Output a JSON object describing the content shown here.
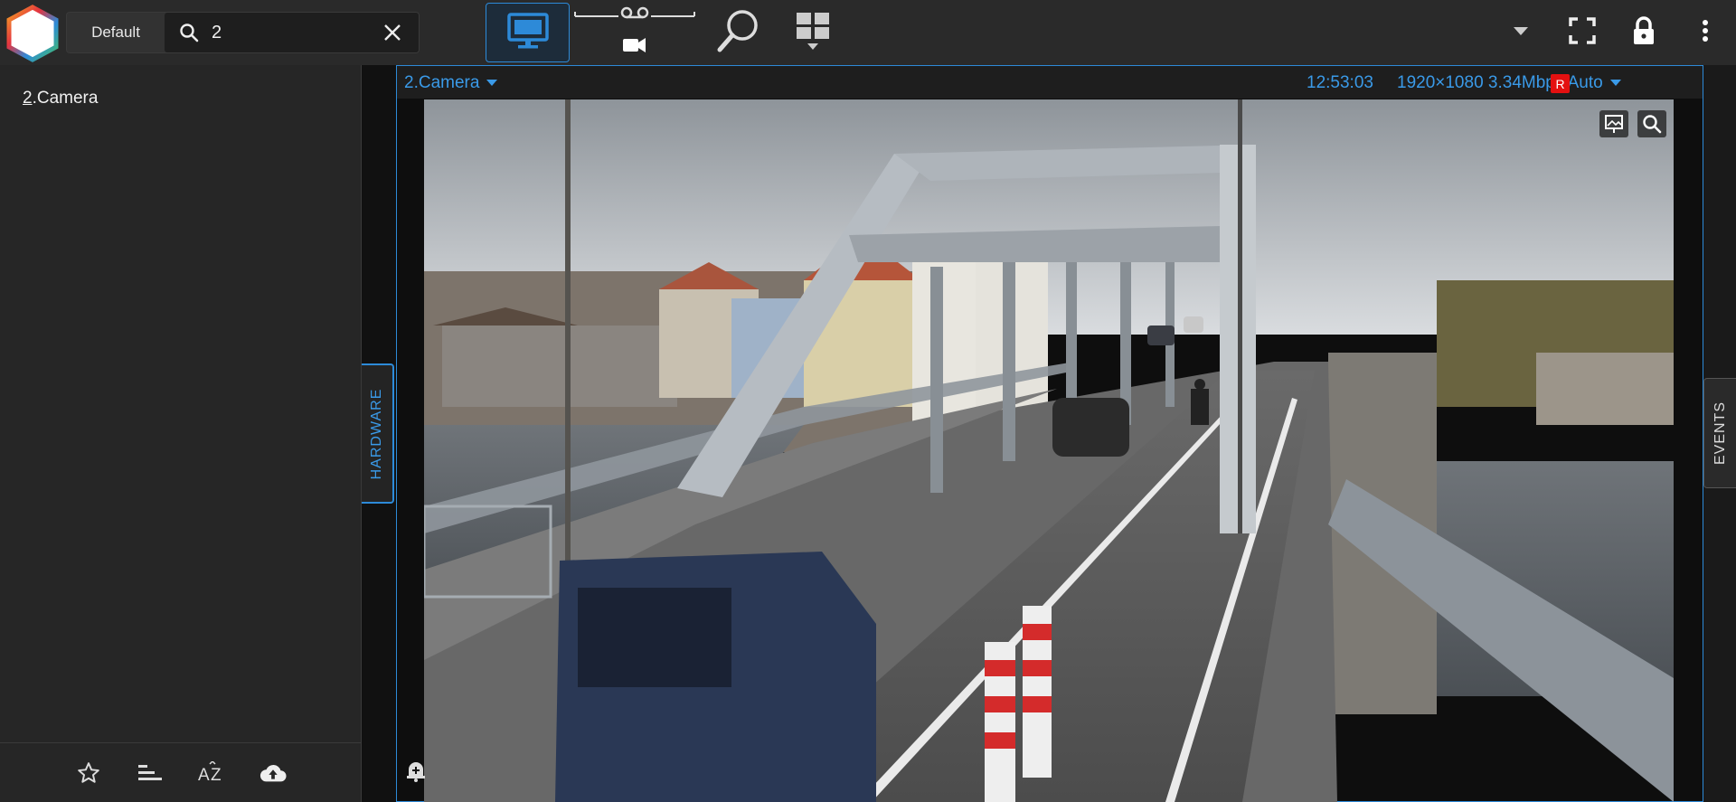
{
  "app": {
    "profile_label": "Default",
    "search_value": "2",
    "search_placeholder": ""
  },
  "toolbar": {
    "icons": [
      "live-monitor-icon",
      "playback-tape-icon",
      "camera-icon",
      "search-magnifier-icon",
      "layout-grid-icon",
      "dropdown-caret-icon",
      "fullscreen-icon",
      "lock-icon",
      "more-vertical-icon"
    ]
  },
  "left_panel": {
    "items": [
      {
        "match": "2",
        "rest": ".Camera"
      }
    ],
    "hardware_tab": "HARDWARE",
    "bottom_icons": [
      "star-icon",
      "sort-bars-icon",
      "sort-az-icon",
      "cloud-upload-icon"
    ]
  },
  "tile": {
    "camera_name": "2.Camera",
    "time": "12:53:03",
    "stream_info": "1920×1080 3.34Mbps Auto",
    "rec_badge": "R"
  },
  "events_tab": "EVENTS",
  "colors": {
    "accent": "#2d8ad8",
    "accent_text": "#3a9ae8",
    "rec": "#e41010",
    "topbar": "#2a2a2a",
    "panel": "#262626"
  }
}
